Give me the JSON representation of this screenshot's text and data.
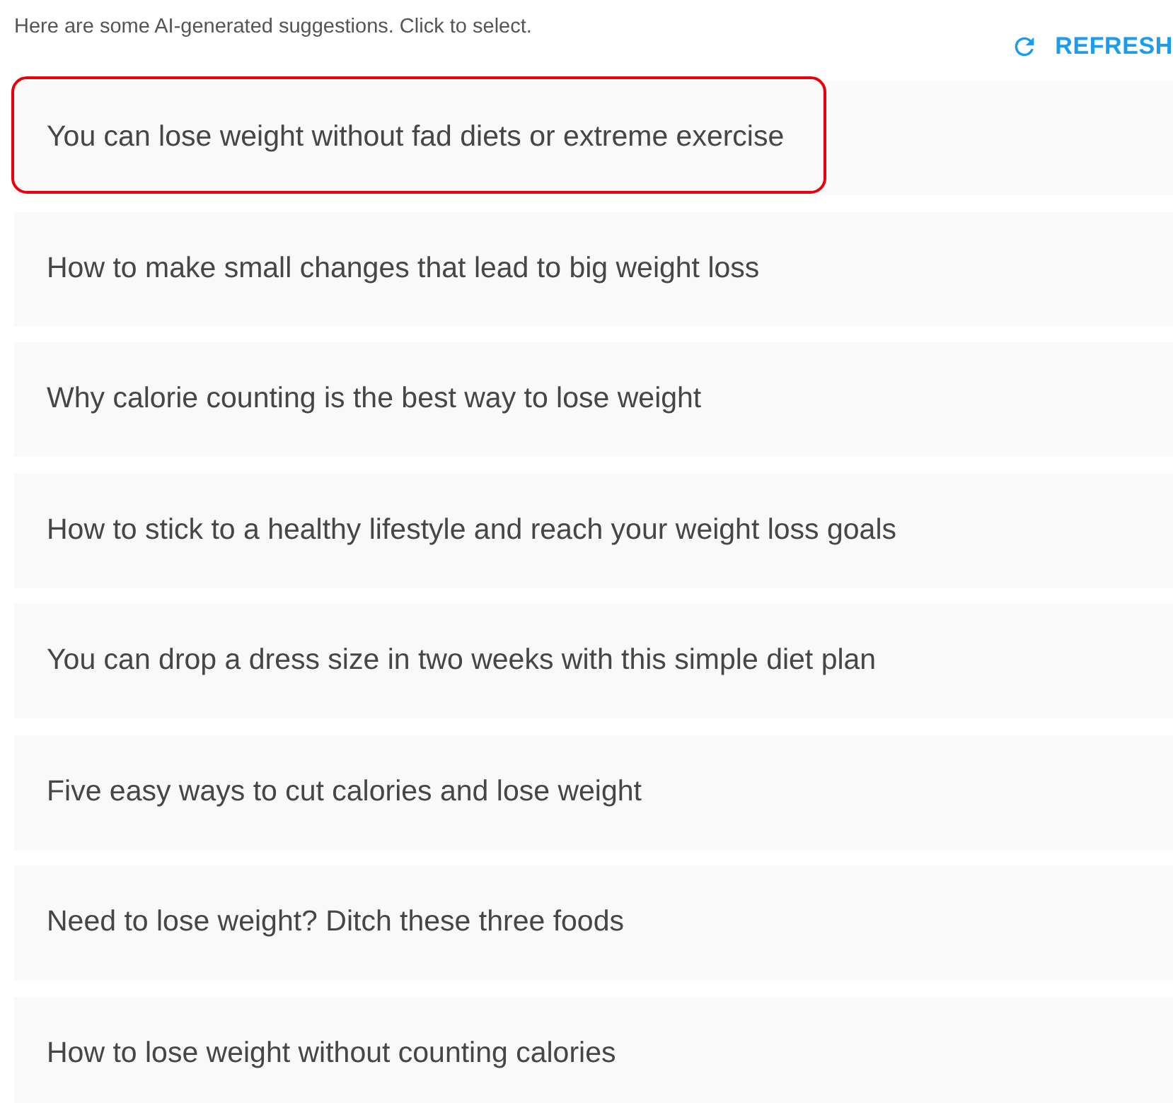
{
  "hint": "Here are some AI-generated suggestions. Click to select.",
  "refresh": {
    "label": "REFRESH"
  },
  "suggestions": [
    {
      "text": "You can lose weight without fad diets or extreme exercise",
      "highlighted": true
    },
    {
      "text": "How to make small changes that lead to big weight loss",
      "highlighted": false
    },
    {
      "text": "Why calorie counting is the best way to lose weight",
      "highlighted": false
    },
    {
      "text": "How to stick to a healthy lifestyle and reach your weight loss goals",
      "highlighted": false
    },
    {
      "text": "You can drop a dress size in two weeks with this simple diet plan",
      "highlighted": false
    },
    {
      "text": "Five easy ways to cut calories and lose weight",
      "highlighted": false
    },
    {
      "text": "Need to lose weight? Ditch these three foods",
      "highlighted": false
    },
    {
      "text": "How to lose weight without counting calories",
      "highlighted": false
    }
  ]
}
